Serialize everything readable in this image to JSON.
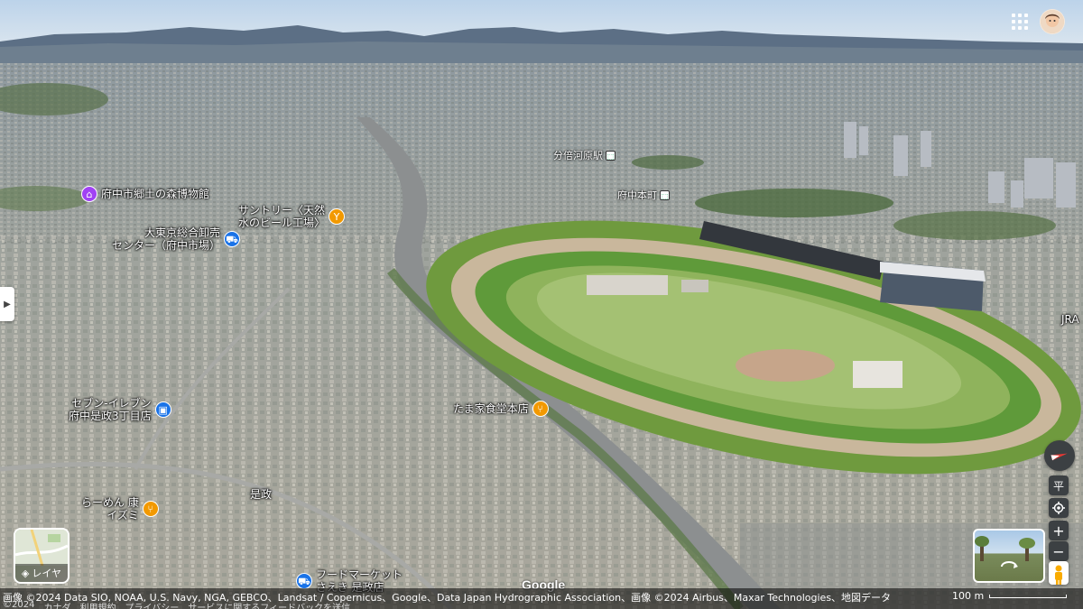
{
  "pois": {
    "museum": {
      "label": "府中市郷土の森博物館",
      "icon": "museum-icon",
      "color": "#a142f4"
    },
    "suntory": {
      "label": "サントリー〈天然\n水のビール工場〉",
      "icon": "brewery-icon",
      "color": "#f29900"
    },
    "market": {
      "label": "大東京総合卸売\nセンター（府中市場）",
      "icon": "shopping-cart-icon",
      "color": "#1a73e8"
    },
    "seven": {
      "label": "セブン-イレブン\n府中是政3丁目店",
      "icon": "store-icon",
      "color": "#1a73e8"
    },
    "tama": {
      "label": "たま家食堂本店",
      "icon": "restaurant-icon",
      "color": "#f29900"
    },
    "ramen": {
      "label": "らーめん 康\nイズミ",
      "icon": "restaurant-icon",
      "color": "#f29900"
    },
    "food_market": {
      "label": "フードマーケット\nさえき 是政店",
      "icon": "shopping-cart-icon",
      "color": "#1a73e8"
    }
  },
  "stations": {
    "bubaigawara": {
      "label": "分倍河原駅"
    },
    "fuchuhonmachi": {
      "label": "府中本町"
    }
  },
  "places": {
    "koremasa": "是政",
    "jra": "JRA"
  },
  "top": {
    "apps_icon": "apps-grid-icon",
    "avatar_icon": "avatar-icon"
  },
  "layer": {
    "label": "レイヤ"
  },
  "controls": {
    "tilt_label": "平",
    "zoom_in": "+",
    "zoom_out": "−"
  },
  "google_logo": "Google",
  "attribution": "画像 ©2024 Data SIO, NOAA, U.S. Navy, NGA, GEBCO、Landsat / Copernicus、Google、Data Japan Hydrographic Association、画像 ©2024 Airbus、Maxar Technologies、地図データ",
  "footer": {
    "year": "©2024",
    "country": "カナダ",
    "terms": "利用規約",
    "privacy": "プライバシー",
    "feedback": "サービスに関するフィードバックを送信"
  },
  "scale": {
    "label": "100 m"
  }
}
